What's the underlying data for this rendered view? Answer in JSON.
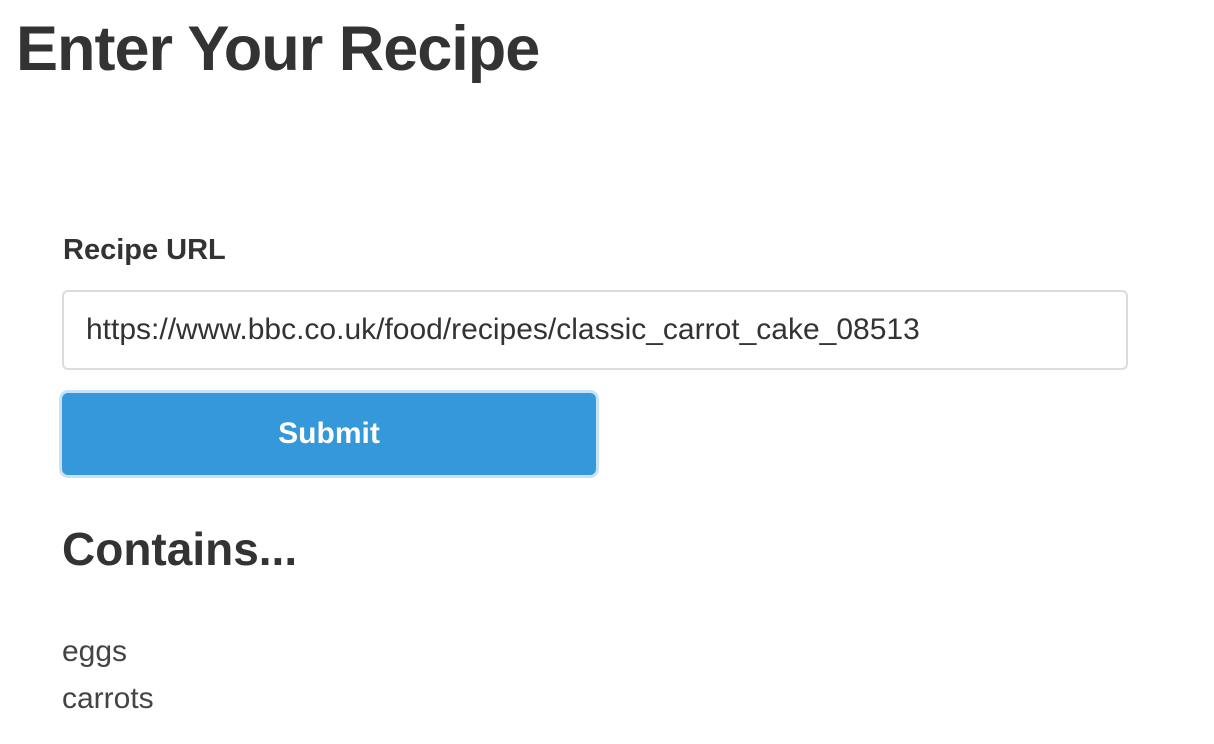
{
  "page": {
    "title": "Enter Your Recipe"
  },
  "form": {
    "label": "Recipe URL",
    "url_value": "https://www.bbc.co.uk/food/recipes/classic_carrot_cake_08513",
    "submit_label": "Submit"
  },
  "results": {
    "heading": "Contains...",
    "ingredients": [
      "eggs",
      "carrots"
    ]
  },
  "colors": {
    "text": "#333333",
    "button_background": "#3498db",
    "button_text": "#ffffff",
    "button_focus_ring": "#c7e2f4",
    "input_border": "#dcdcdc"
  }
}
